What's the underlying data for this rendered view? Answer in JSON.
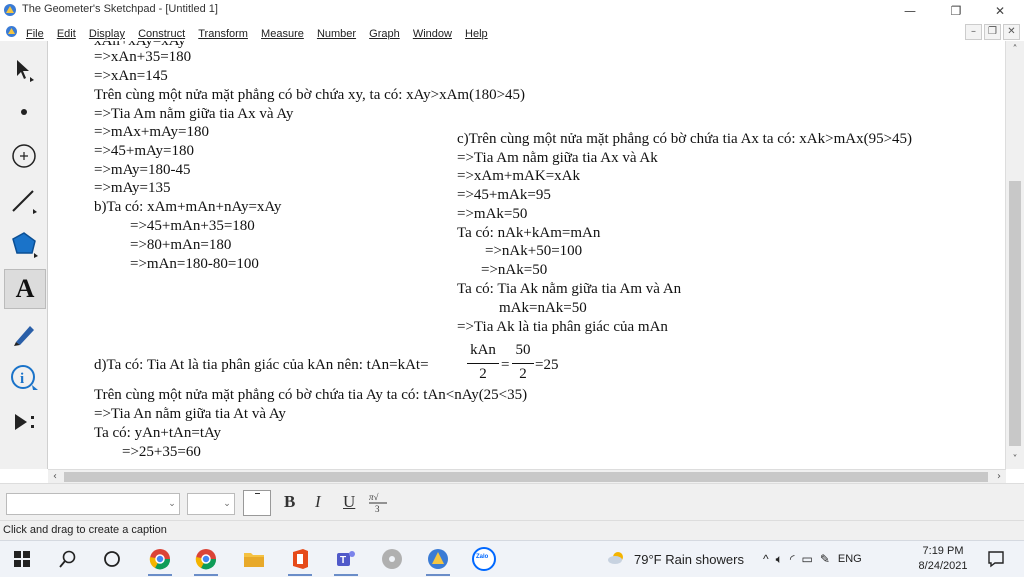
{
  "window": {
    "title": "The Geometer's Sketchpad - [Untitled 1]",
    "minimize": "—",
    "maximize": "❐",
    "close": "✕"
  },
  "menu": {
    "items": [
      "File",
      "Edit",
      "Display",
      "Construct",
      "Transform",
      "Measure",
      "Number",
      "Graph",
      "Window",
      "Help"
    ],
    "doc_buttons": [
      "–",
      "❐",
      "✕"
    ]
  },
  "toolbox": {
    "tools": [
      "arrow-tool",
      "point-tool",
      "compass-tool",
      "straightedge-tool",
      "polygon-tool",
      "text-tool",
      "marker-tool",
      "information-tool",
      "custom-tool"
    ],
    "text_tool_glyph": "A"
  },
  "canvas": {
    "cut_top": "xAn+xAy=xAy",
    "left_lines": [
      "=>xAn+35=180",
      "=>xAn=145",
      "Trên cùng một nửa mặt phẳng có bờ chứa xy, ta có: xAy>xAm(180>45)",
      "=>Tia Am nằm giữa tia Ax và Ay",
      "=>mAx+mAy=180",
      "=>45+mAy=180",
      "=>mAy=180-45",
      "=>mAy=135",
      "b)Ta có: xAm+mAn+nAy=xAy",
      "=>45+mAn+35=180",
      "=>80+mAn=180",
      "=>mAn=180-80=100"
    ],
    "right_lines": [
      "c)Trên cùng một nửa mặt phẳng có bờ chứa tia Ax ta có: xAk>mAx(95>45)",
      "=>Tia Am nằm giữa tia Ax và Ak",
      "=>xAm+mAK=xAk",
      "=>45+mAk=95",
      "=>mAk=50",
      "Ta có: nAk+kAm=mAn",
      "=>nAk+50=100",
      "=>nAk=50",
      "Ta có: Tia Ak nằm giữa tia Am và An",
      "mAk=nAk=50",
      "=>Tia Ak là tia phân giác của mAn"
    ],
    "d_prefix": "d)Ta có: Tia At là tia phân giác của kAn nên: tAn=kAt=",
    "d_frac1_num": "kAn",
    "d_frac1_den": "2",
    "d_eq": "=",
    "d_frac2_num": "50",
    "d_frac2_den": "2",
    "d_result": "=25",
    "bottom_lines": [
      "Trên cùng một nửa mặt phẳng có bờ chứa tia Ay ta có: tAn<nAy(25<35)",
      "=>Tia An nằm giữa tia At và Ay",
      "Ta có: yAn+tAn=tAy",
      "=>25+35=60"
    ]
  },
  "textbar": {
    "bold": "B",
    "italic": "I",
    "underline": "U"
  },
  "status": {
    "text": "Click and drag to create a caption"
  },
  "taskbar": {
    "weather": "79°F  Rain showers",
    "lang": "ENG",
    "time": "7:19 PM",
    "date": "8/24/2021",
    "zalo": "Zalo"
  }
}
